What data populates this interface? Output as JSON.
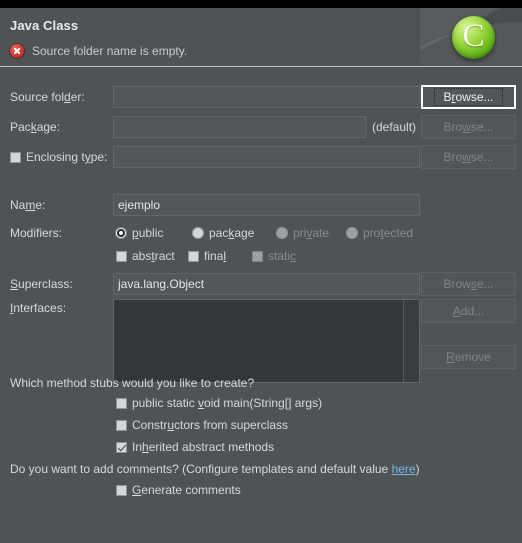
{
  "dialog": {
    "title": "Java Class",
    "status_message": "Source folder name is empty.",
    "status_icon": "error-circle-x-icon",
    "logo_icon": "eclipse-c-logo-icon",
    "logo_letter": "C"
  },
  "fields": {
    "source_folder": {
      "label_pre": "Source fol",
      "label_mnemonic": "d",
      "label_post": "er:",
      "value": "",
      "browse_pre": "B",
      "browse_mnemonic": "r",
      "browse_post": "owse...",
      "browse_label": "Browse..."
    },
    "package": {
      "label_pre": "Pac",
      "label_mnemonic": "k",
      "label_post": "age:",
      "value": "",
      "default_note": "(default)",
      "browse_pre": "Bro",
      "browse_mnemonic": "w",
      "browse_post": "se...",
      "browse_label": "Browse..."
    },
    "enclosing_type": {
      "label_pre": "Enclosing t",
      "label_mnemonic": "y",
      "label_post": "pe:",
      "checked": false,
      "value": "",
      "browse_pre": "Bro",
      "browse_mnemonic": "w",
      "browse_post": "se...",
      "browse_label": "Browse..."
    },
    "name": {
      "label_pre": "Na",
      "label_mnemonic": "m",
      "label_post": "e:",
      "value": "ejemplo"
    },
    "modifiers": {
      "label": "Modifiers:",
      "radios": [
        {
          "pre": "",
          "mnemonic": "p",
          "post": "ublic",
          "label": "public",
          "selected": true,
          "enabled": true
        },
        {
          "pre": "pac",
          "mnemonic": "k",
          "post": "age",
          "label": "package",
          "selected": false,
          "enabled": true
        },
        {
          "pre": "pri",
          "mnemonic": "v",
          "post": "ate",
          "label": "private",
          "selected": false,
          "enabled": false
        },
        {
          "pre": "pro",
          "mnemonic": "t",
          "post": "ected",
          "label": "protected",
          "selected": false,
          "enabled": false
        }
      ],
      "checks": [
        {
          "pre": "abs",
          "mnemonic": "t",
          "post": "ract",
          "label": "abstract",
          "checked": false,
          "enabled": true
        },
        {
          "pre": "fina",
          "mnemonic": "l",
          "post": "",
          "label": "final",
          "checked": false,
          "enabled": true
        },
        {
          "pre": "stati",
          "mnemonic": "c",
          "post": "",
          "label": "static",
          "checked": false,
          "enabled": false
        }
      ]
    },
    "superclass": {
      "label_pre": "",
      "label_mnemonic": "S",
      "label_post": "uperclass:",
      "value": "java.lang.Object",
      "browse_pre": "Brow",
      "browse_mnemonic": "s",
      "browse_post": "e...",
      "browse_label": "Browse..."
    },
    "interfaces": {
      "label_pre": "",
      "label_mnemonic": "I",
      "label_post": "nterfaces:",
      "items": [],
      "add_pre": "",
      "add_mnemonic": "A",
      "add_post": "dd...",
      "add_label": "Add...",
      "remove_pre": "",
      "remove_mnemonic": "R",
      "remove_post": "emove",
      "remove_label": "Remove"
    }
  },
  "stubs": {
    "question": "Which method stubs would you like to create?",
    "options": [
      {
        "pre": "public static ",
        "mnemonic": "v",
        "post": "oid main(String[] args)",
        "label": "public static void main(String[] args)",
        "checked": false
      },
      {
        "pre": "Constr",
        "mnemonic": "u",
        "post": "ctors from superclass",
        "label": "Constructors from superclass",
        "checked": false
      },
      {
        "pre": "In",
        "mnemonic": "h",
        "post": "erited abstract methods",
        "label": "Inherited abstract methods",
        "checked": true
      }
    ]
  },
  "comments": {
    "question_pre": "Do you want to add comments? (Configure templates and default value ",
    "link_text": "here",
    "question_post": ")",
    "generate": {
      "pre": "",
      "mnemonic": "G",
      "post": "enerate comments",
      "label": "Generate comments",
      "checked": false
    }
  },
  "colors": {
    "background": "#4e5356",
    "field_bg": "#52575a",
    "list_bg": "#333739",
    "text": "#d6d9dc",
    "text_disabled": "#868b8f",
    "link": "#77b6e8",
    "error_red": "#cf3a33",
    "logo_green": "#6fbe20"
  }
}
